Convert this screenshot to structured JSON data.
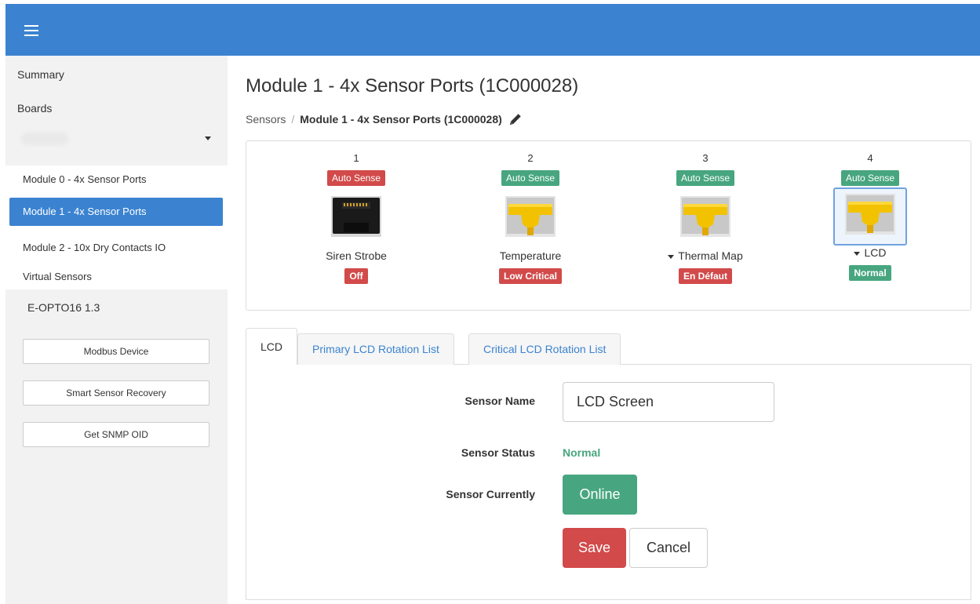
{
  "colors": {
    "primary": "#3b83d0",
    "success": "#47a67f",
    "danger": "#d24a4a",
    "sidebar_bg": "#f2f2f2"
  },
  "sidebar": {
    "links": [
      {
        "label": "Summary"
      },
      {
        "label": "Boards"
      }
    ],
    "modules": [
      {
        "label": "Module 0 - 4x Sensor Ports",
        "active": false
      },
      {
        "label": "Module 1 - 4x Sensor Ports",
        "active": true
      },
      {
        "label": "Module 2 - 10x Dry Contacts IO",
        "active": false
      },
      {
        "label": "Virtual Sensors",
        "active": false
      }
    ],
    "version": "E-OPTO16 1.3",
    "buttons": [
      {
        "label": "Modbus Device"
      },
      {
        "label": "Smart Sensor Recovery"
      },
      {
        "label": "Get SNMP OID"
      }
    ]
  },
  "header": {
    "title": "Module 1 - 4x Sensor Ports (1C000028)",
    "breadcrumb": {
      "root": "Sensors",
      "separator": "/",
      "current": "Module 1 - 4x Sensor Ports (1C000028)"
    }
  },
  "ports": [
    {
      "number": "1",
      "mode": "Auto Sense",
      "mode_color": "red",
      "icon": "rj45-black-icon",
      "name": "Siren Strobe",
      "dropdown": false,
      "status": "Off",
      "status_color": "red",
      "selected": false
    },
    {
      "number": "2",
      "mode": "Auto Sense",
      "mode_color": "green",
      "icon": "rj45-yellow-icon",
      "name": "Temperature",
      "dropdown": false,
      "status": "Low Critical",
      "status_color": "red",
      "selected": false
    },
    {
      "number": "3",
      "mode": "Auto Sense",
      "mode_color": "green",
      "icon": "rj45-yellow-icon",
      "name": "Thermal Map",
      "dropdown": true,
      "status": "En Défaut",
      "status_color": "red",
      "selected": false
    },
    {
      "number": "4",
      "mode": "Auto Sense",
      "mode_color": "green",
      "icon": "rj45-yellow-icon",
      "name": "LCD",
      "dropdown": true,
      "status": "Normal",
      "status_color": "green",
      "selected": true
    }
  ],
  "tabs": [
    {
      "label": "LCD",
      "active": true
    },
    {
      "label": "Primary LCD Rotation List",
      "active": false
    },
    {
      "label": "Critical LCD Rotation List",
      "active": false
    }
  ],
  "form": {
    "sensor_name_label": "Sensor Name",
    "sensor_name_value": "LCD Screen",
    "sensor_status_label": "Sensor Status",
    "sensor_status_value": "Normal",
    "sensor_currently_label": "Sensor Currently",
    "sensor_currently_value": "Online",
    "save_label": "Save",
    "cancel_label": "Cancel"
  }
}
